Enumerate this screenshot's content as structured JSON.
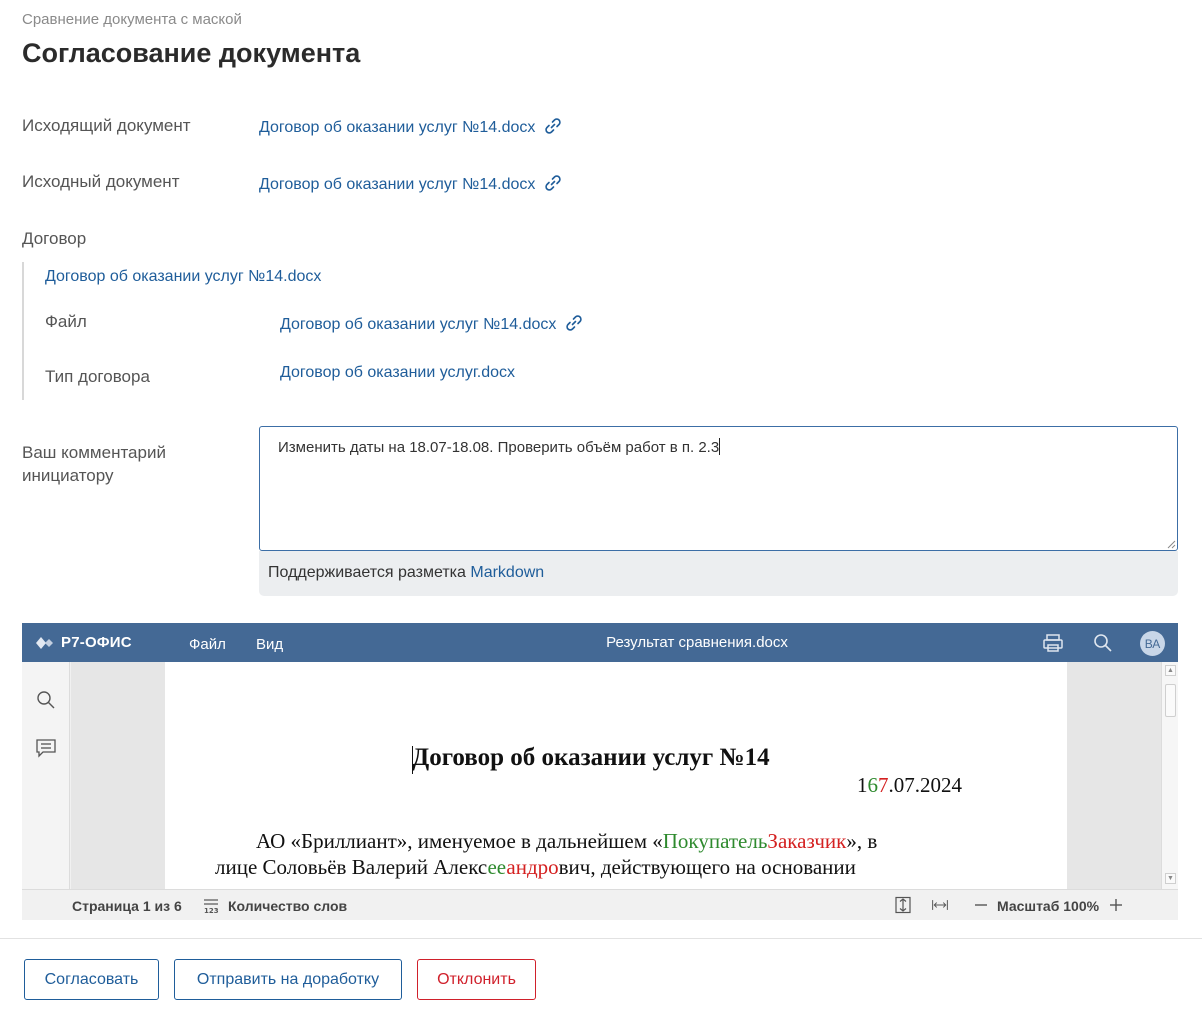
{
  "header": {
    "breadcrumb": "Сравнение документа с маской",
    "title": "Согласование документа"
  },
  "fields": {
    "outgoing": {
      "label": "Исходящий документ",
      "value": "Договор об оказании услуг №14.docx"
    },
    "source": {
      "label": "Исходный документ",
      "value": "Договор об оказании услуг №14.docx"
    },
    "contract": {
      "label": "Договор",
      "title": "Договор об оказании услуг №14.docx",
      "file_label": "Файл",
      "file_value": "Договор об оказании услуг №14.docx",
      "type_label": "Тип договора",
      "type_value": "Договор об оказании услуг.docx"
    }
  },
  "comment": {
    "label_line1": "Ваш комментарий",
    "label_line2": "инициатору",
    "value": "Изменить даты на 18.07-18.08. Проверить объём работ в п. 2.3",
    "markdown_prefix": "Поддерживается разметка",
    "markdown_link": "Markdown"
  },
  "editor": {
    "logo": "Р7-ОФИС",
    "menu": [
      "Файл",
      "Вид"
    ],
    "doc_title": "Результат сравнения.docx",
    "avatar": "ВА",
    "document": {
      "heading": "Договор об оказании услуг №14",
      "date_parts": {
        "a": "1",
        "ins": "6",
        "del": "7",
        "rest": ".07.2024"
      },
      "line1": {
        "a": "АО «Бриллиант», именуемое в дальнейшем «",
        "ins": "Покупатель",
        "del": "Заказчик",
        "b": "», в"
      },
      "line2": {
        "a": "лице Соловьёв Валерий Алекс",
        "ins": "ее",
        "del": "андро",
        "b": "вич, действующего на основании"
      }
    },
    "status": {
      "page": "Страница 1 из 6",
      "word_count": "Количество слов",
      "zoom": "Масштаб 100%"
    },
    "colors": {
      "header": "#446995",
      "inserted": "#2e8a2e",
      "deleted": "#d42020"
    }
  },
  "actions": {
    "approve": "Согласовать",
    "rework": "Отправить на доработку",
    "reject": "Отклонить"
  }
}
